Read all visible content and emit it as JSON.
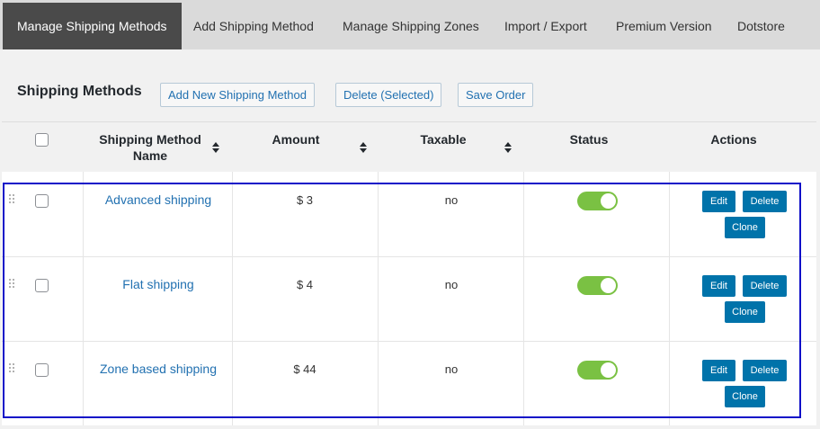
{
  "tabs": [
    {
      "label": "Manage Shipping Methods",
      "active": true
    },
    {
      "label": "Add Shipping Method"
    },
    {
      "label": "Manage Shipping Zones"
    },
    {
      "label": "Import / Export"
    },
    {
      "label": "Premium Version"
    },
    {
      "label": "Dotstore"
    }
  ],
  "panel": {
    "title": "Shipping Methods",
    "buttons": {
      "add_new": "Add New Shipping Method",
      "delete_selected": "Delete (Selected)",
      "save_order": "Save Order"
    }
  },
  "table": {
    "columns": {
      "name": "Shipping Method Name",
      "amount": "Amount",
      "taxable": "Taxable",
      "status": "Status",
      "actions": "Actions"
    },
    "rows": [
      {
        "name": "Advanced shipping",
        "amount": "$ 3",
        "taxable": "no",
        "status_on": true
      },
      {
        "name": "Flat shipping",
        "amount": "$ 4",
        "taxable": "no",
        "status_on": true
      },
      {
        "name": "Zone based shipping",
        "amount": "$ 44",
        "taxable": "no",
        "status_on": true
      }
    ],
    "actions": {
      "edit": "Edit",
      "delete": "Delete",
      "clone": "Clone"
    }
  },
  "colors": {
    "active_tab": "#4a4a4a",
    "link": "#2271b1",
    "toggle_on": "#7ac143",
    "action_button": "#0073aa",
    "selection_border": "#1010c8"
  }
}
